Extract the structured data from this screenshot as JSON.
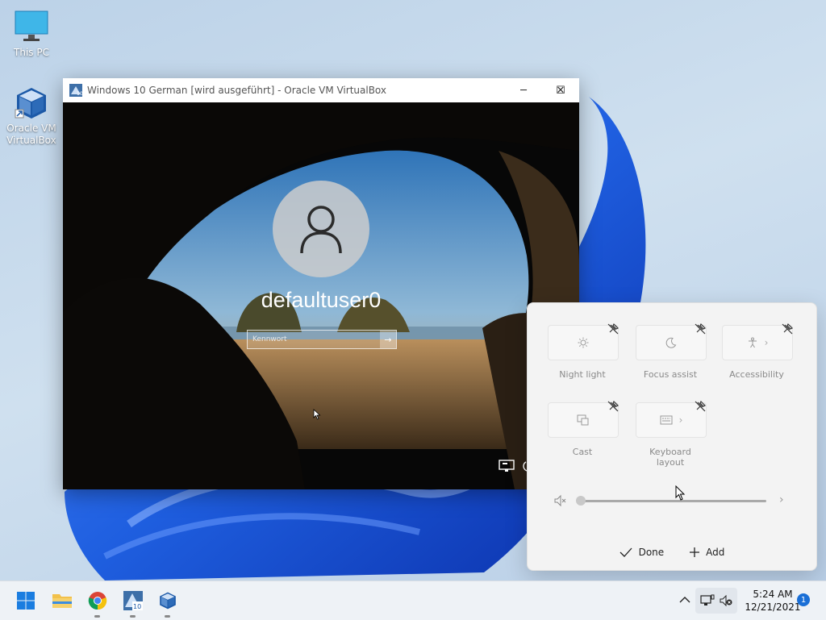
{
  "desktop": {
    "icons": [
      {
        "label": "This PC"
      },
      {
        "label": "Oracle VM VirtualBox",
        "line1": "Oracle VM",
        "line2": "VirtualBox"
      }
    ]
  },
  "vm_window": {
    "title": "Windows 10 German [wird ausgeführt] - Oracle VM VirtualBox",
    "controls": {
      "minimize": "─",
      "maximize": "☐",
      "close": "✕"
    },
    "lock_screen": {
      "username": "defaultuser0",
      "password_placeholder": "Kennwort",
      "submit_glyph": "→"
    }
  },
  "quick_settings": {
    "tiles": [
      {
        "label": "Night light",
        "icon": "sun-icon"
      },
      {
        "label": "Focus assist",
        "icon": "moon-icon"
      },
      {
        "label": "Accessibility",
        "icon": "accessibility-icon"
      },
      {
        "label": "Cast",
        "icon": "cast-icon"
      },
      {
        "label": "Keyboard layout",
        "icon": "keyboard-icon"
      }
    ],
    "volume": {
      "level": 0,
      "muted": true
    },
    "done_label": "Done",
    "add_label": "Add"
  },
  "taskbar": {
    "apps": [
      "start-button",
      "file-explorer",
      "chrome",
      "windows-10-vm",
      "virtualbox"
    ],
    "clock": {
      "time": "5:24 AM",
      "date": "12/21/2021"
    },
    "notification_count": "1"
  },
  "colors": {
    "accent": "#1a6fd6",
    "wallpaper_bloom": "#1f5fe0",
    "wallpaper_bg": "#c4d8ec"
  }
}
